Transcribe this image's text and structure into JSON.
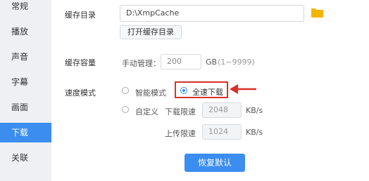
{
  "sidebar": {
    "items": [
      {
        "label": "常规"
      },
      {
        "label": "播放"
      },
      {
        "label": "声音"
      },
      {
        "label": "字幕"
      },
      {
        "label": "画面"
      },
      {
        "label": "下载"
      },
      {
        "label": "关联"
      }
    ],
    "active": "下载"
  },
  "cache_dir": {
    "label": "缓存目录",
    "path": "D:\\XmpCache",
    "open_button": "打开缓存目录",
    "icon": "folder-icon"
  },
  "cache_size": {
    "label": "缓存容量",
    "manual_label": "手动管理：",
    "value": "200",
    "unit": "GB",
    "range": "(1~9999)"
  },
  "speed_mode": {
    "label": "速度模式",
    "options": {
      "smart": "智能模式",
      "full": "全速下载",
      "custom": "自定义"
    },
    "selected": "全速下载",
    "download_limit_label": "下载限速",
    "download_limit_value": "2048",
    "upload_limit_label": "上传限速",
    "upload_limit_value": "1024",
    "unit": "KB/s"
  },
  "restore_button": "恢复默认",
  "colors": {
    "accent": "#3b8df0",
    "annotation": "#d9302a",
    "folder": "#f5b400"
  }
}
